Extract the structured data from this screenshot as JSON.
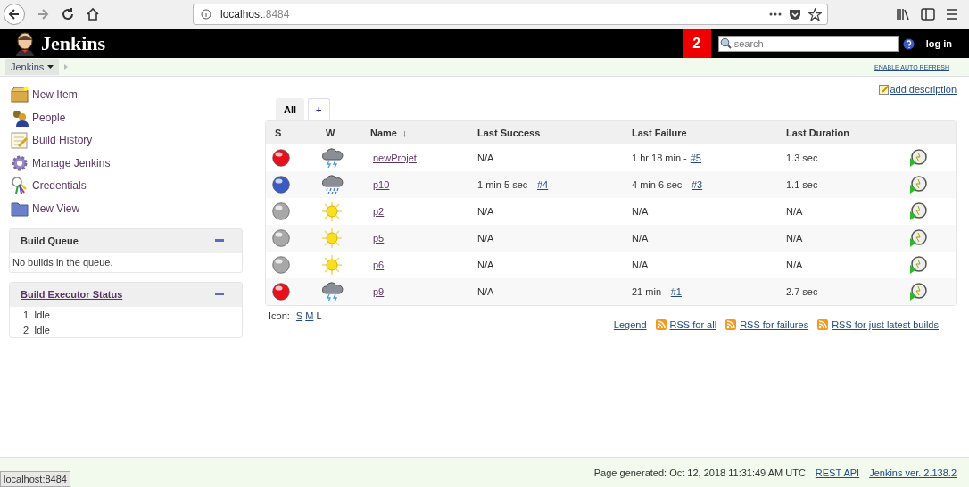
{
  "browser": {
    "url_host": "localhost",
    "url_port": ":8484",
    "status_tooltip": "localhost:8484"
  },
  "header": {
    "logo": "Jenkins",
    "badge": "2",
    "search_placeholder": "search",
    "login": "log in"
  },
  "breadcrumb": {
    "item": "Jenkins",
    "auto_refresh": "ENABLE AUTO REFRESH"
  },
  "sidebar": {
    "items": [
      {
        "kind": "new-item",
        "label": "New Item"
      },
      {
        "kind": "people",
        "label": "People"
      },
      {
        "kind": "history",
        "label": "Build History"
      },
      {
        "kind": "manage",
        "label": "Manage Jenkins"
      },
      {
        "kind": "credentials",
        "label": "Credentials"
      },
      {
        "kind": "new-view",
        "label": "New View"
      }
    ]
  },
  "build_queue": {
    "title": "Build Queue",
    "message": "No builds in the queue."
  },
  "executors": {
    "title": "Build Executor Status",
    "rows": [
      {
        "number": "1",
        "status": "Idle"
      },
      {
        "number": "2",
        "status": "Idle"
      }
    ]
  },
  "add_description": "add description",
  "tabs": [
    {
      "label": "All",
      "selected": true
    },
    {
      "label": "+",
      "selected": false
    }
  ],
  "table": {
    "columns": [
      {
        "label": "S"
      },
      {
        "label": "W"
      },
      {
        "label": "Name",
        "sort": "↓"
      },
      {
        "label": "Last Success"
      },
      {
        "label": "Last Failure"
      },
      {
        "label": "Last Duration"
      }
    ],
    "rows": [
      {
        "color": "#e8101a",
        "kind": "storm",
        "name": "newProjet",
        "last_success": {
          "text": "N/A"
        },
        "last_failure": {
          "text": "1 hr 18 min -",
          "build": "#5"
        },
        "duration": "1.3 sec"
      },
      {
        "color": "#3a5bc4",
        "kind": "rain",
        "name": "p10",
        "last_success": {
          "text": "1 min 5 sec -",
          "build": "#4"
        },
        "last_failure": {
          "text": "4 min 6 sec -",
          "build": "#3"
        },
        "duration": "1.1 sec"
      },
      {
        "color": "#a8a8a8",
        "kind": "sun",
        "name": "p2",
        "last_success": {
          "text": "N/A"
        },
        "last_failure": {
          "text": "N/A"
        },
        "duration": "N/A"
      },
      {
        "color": "#a8a8a8",
        "kind": "sun",
        "name": "p5",
        "last_success": {
          "text": "N/A"
        },
        "last_failure": {
          "text": "N/A"
        },
        "duration": "N/A"
      },
      {
        "color": "#a8a8a8",
        "kind": "sun",
        "name": "p6",
        "last_success": {
          "text": "N/A"
        },
        "last_failure": {
          "text": "N/A"
        },
        "duration": "N/A"
      },
      {
        "color": "#e8101a",
        "kind": "storm",
        "name": "p9",
        "last_success": {
          "text": "N/A"
        },
        "last_failure": {
          "text": "21 min -",
          "build": "#1"
        },
        "duration": "2.7 sec"
      }
    ]
  },
  "icon_size": {
    "label": "Icon:",
    "options": [
      {
        "label": "S",
        "selected": false
      },
      {
        "label": "M",
        "selected": false
      },
      {
        "label": "L",
        "selected": true
      }
    ]
  },
  "links": [
    {
      "kind": "legend",
      "label": "Legend"
    },
    {
      "kind": "rss",
      "label": "RSS for all"
    },
    {
      "kind": "rss",
      "label": "RSS for failures"
    },
    {
      "kind": "rss",
      "label": "RSS for just latest builds"
    }
  ],
  "footer": {
    "generated": "Page generated: Oct 12, 2018 11:31:49 AM UTC",
    "rest_api": "REST API",
    "version": "Jenkins ver. 2.138.2"
  }
}
